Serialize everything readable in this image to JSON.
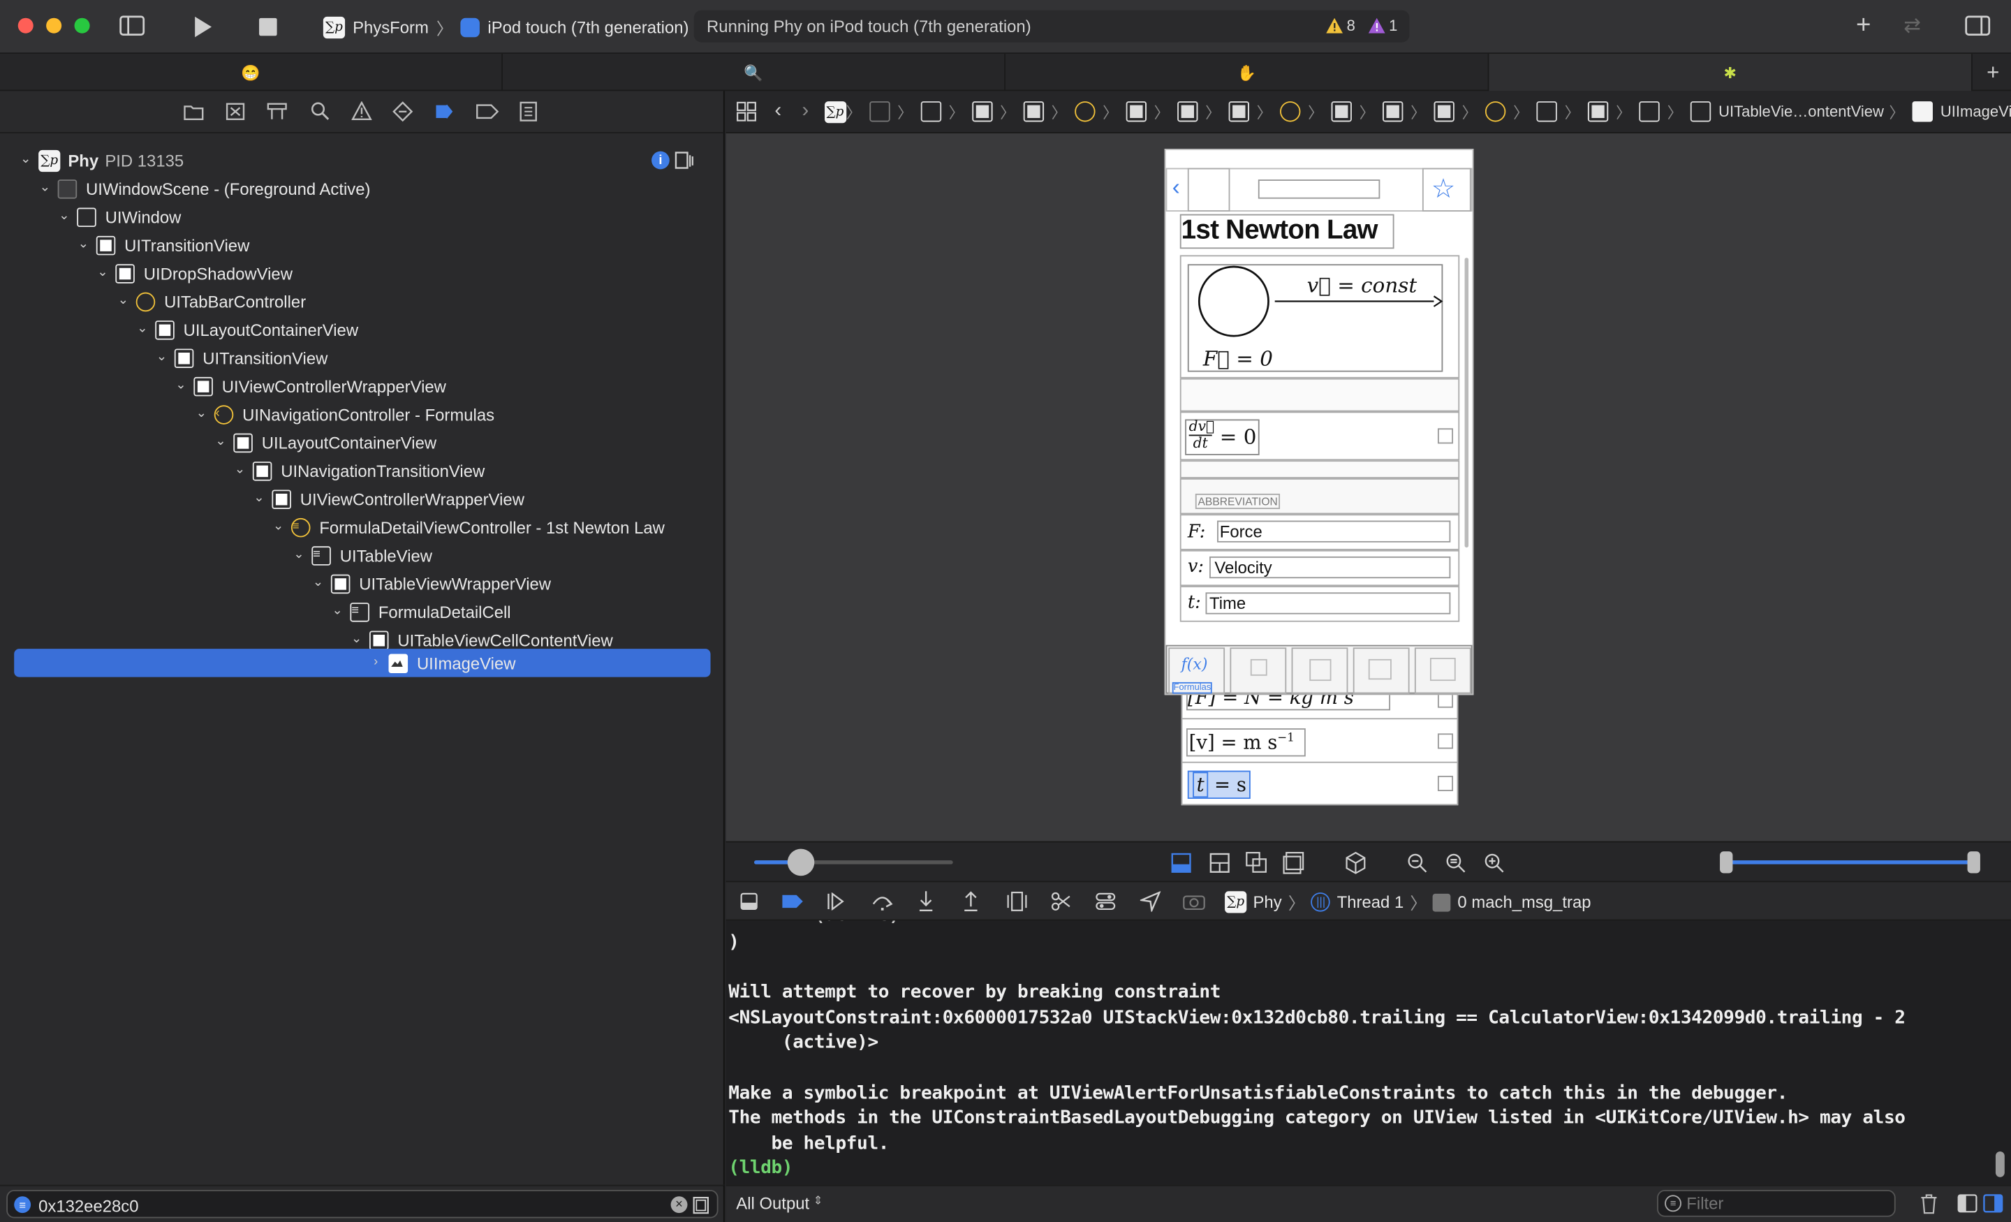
{
  "window": {
    "traffic_lights": [
      "#ff5f57",
      "#febc2e",
      "#28c840"
    ]
  },
  "toolbar": {
    "project": "PhysForm",
    "device": "iPod touch (7th generation)",
    "status": "Running Phy on iPod touch (7th generation)",
    "warnings": "8",
    "issues": "1"
  },
  "navigator": {
    "process_name": "Phy",
    "process_pid": "PID 13135",
    "items": [
      {
        "label": "UIWindowScene - (Foreground Active)"
      },
      {
        "label": "UIWindow"
      },
      {
        "label": "UITransitionView"
      },
      {
        "label": "UIDropShadowView"
      },
      {
        "label": "UITabBarController"
      },
      {
        "label": "UILayoutContainerView"
      },
      {
        "label": "UITransitionView"
      },
      {
        "label": "UIViewControllerWrapperView"
      },
      {
        "label": "UINavigationController - Formulas"
      },
      {
        "label": "UILayoutContainerView"
      },
      {
        "label": "UINavigationTransitionView"
      },
      {
        "label": "UIViewControllerWrapperView"
      },
      {
        "label": "FormulaDetailViewController - 1st Newton Law"
      },
      {
        "label": "UITableView"
      },
      {
        "label": "UITableViewWrapperView"
      },
      {
        "label": "FormulaDetailCell"
      },
      {
        "label": "UITableViewCellContentView"
      },
      {
        "label": "UIImageView"
      }
    ],
    "filter_value": "0x132ee28c0"
  },
  "jumpbar": {
    "crumb_tableview": "UITableVie…ontentView",
    "crumb_imageview": "UIImageView"
  },
  "device_view": {
    "title": "1st Newton Law",
    "formula_top": "v⃗ = const",
    "formula_force": "F⃗ = 0",
    "formula_deriv_num": "dv⃗",
    "formula_deriv_den": "dt",
    "formula_deriv_rhs": "= 0",
    "section_header": "ABBREVIATION",
    "abbreviations": [
      {
        "symbol": "F:",
        "name": "Force"
      },
      {
        "symbol": "v:",
        "name": "Velocity"
      },
      {
        "symbol": "t:",
        "name": "Time"
      }
    ],
    "tab_formulas_icon": "f(x)",
    "tab_formulas_label": "Formulas",
    "unit_f": "[F] = N = kg m s",
    "unit_v": "[v] = m s",
    "unit_v_sup": "−1",
    "unit_t_lhs": "t",
    "unit_t_rhs": "= s"
  },
  "debug_bar": {
    "process": "Phy",
    "thread": "Thread 1",
    "frame": "0 mach_msg_trap"
  },
  "console": {
    "lines": [
      ")",
      "",
      "Will attempt to recover by breaking constraint",
      "<NSLayoutConstraint:0x6000017532a0 UIStackView:0x132d0cb80.trailing == CalculatorView:0x1342099d0.trailing - 2",
      "     (active)>",
      "",
      "Make a symbolic breakpoint at UIViewAlertForUnsatisfiableConstraints to catch this in the debugger.",
      "The methods in the UIConstraintBasedLayoutDebugging category on UIView listed in <UIKitCore/UIView.h> may also",
      "    be helpful.",
      "(lldb)"
    ],
    "output_selector": "All Output",
    "filter_placeholder": "Filter"
  },
  "colors": {
    "accent": "#3a6fd8",
    "warning": "#f2c23a",
    "issue": "#a05bd6",
    "lldb": "#6fd36f"
  }
}
